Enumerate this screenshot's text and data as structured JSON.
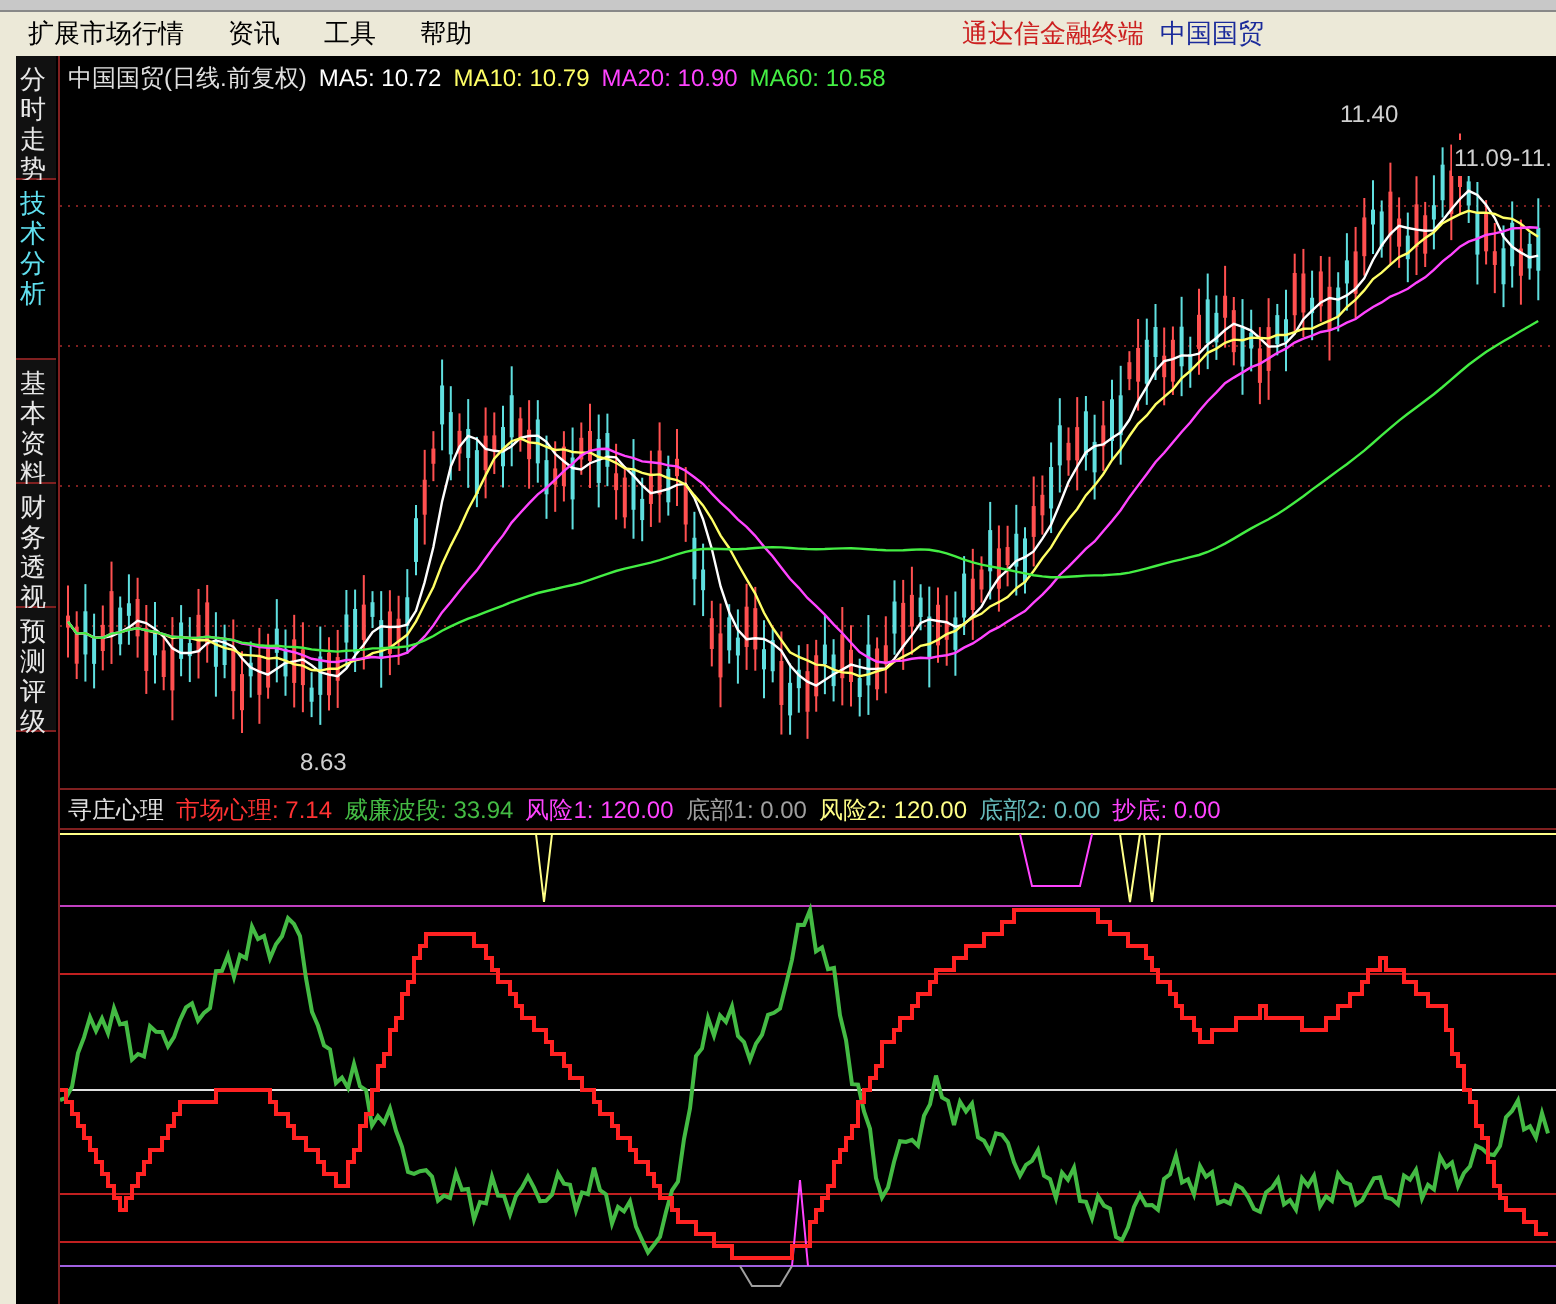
{
  "menu": [
    {
      "label": "扩展市场行情"
    },
    {
      "label": "资讯"
    },
    {
      "label": "工具"
    },
    {
      "label": "帮助"
    }
  ],
  "title_bar": {
    "product": "通达信金融终端",
    "stock": "中国国贸"
  },
  "side_tabs": [
    {
      "label": "分时走势",
      "selected": false
    },
    {
      "label": "技术分析",
      "selected": true
    },
    {
      "label": "基本资料",
      "selected": false
    },
    {
      "label": "财务透视",
      "selected": false
    },
    {
      "label": "预测评级",
      "selected": false
    }
  ],
  "price_chart": {
    "title": "中国国贸(日线.前复权)",
    "indicators": [
      {
        "label": "MA5: 10.72",
        "color": "#ffffff"
      },
      {
        "label": "MA10: 10.79",
        "color": "#ffff66"
      },
      {
        "label": "MA20: 10.90",
        "color": "#ff44ff"
      },
      {
        "label": "MA60: 10.58",
        "color": "#44ee44"
      }
    ],
    "labels": [
      {
        "kind": "high",
        "text": "11.40"
      },
      {
        "kind": "low",
        "text": "8.63"
      },
      {
        "kind": "range",
        "text": "11.09-11."
      }
    ]
  },
  "indicator_panel": {
    "title": "寻庄心理",
    "series": [
      {
        "label": "市场心理: 7.14",
        "color": "#ff3333"
      },
      {
        "label": "威廉波段: 33.94",
        "color": "#44bb44"
      },
      {
        "label": "风险1: 120.00",
        "color": "#ff44ff"
      },
      {
        "label": "底部1: 0.00",
        "color": "#a0a0a0"
      },
      {
        "label": "风险2: 120.00",
        "color": "#ffff88"
      },
      {
        "label": "底部2: 0.00",
        "color": "#66bbbb"
      },
      {
        "label": "抄底: 0.00",
        "color": "#ff44ff"
      }
    ]
  }
}
